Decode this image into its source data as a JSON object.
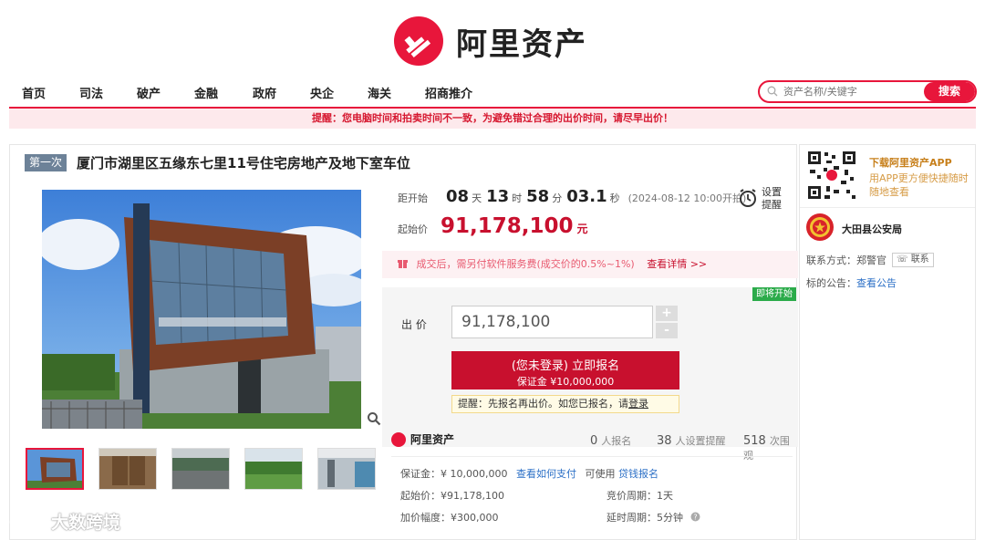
{
  "brand": {
    "name": "阿里资产",
    "accent": "#e8163b"
  },
  "nav": {
    "items": [
      "首页",
      "司法",
      "破产",
      "金融",
      "政府",
      "央企",
      "海关",
      "招商推介"
    ]
  },
  "search": {
    "placeholder": "资产名称/关键字",
    "button": "搜索"
  },
  "notice": "提醒：您电脑时间和拍卖时间不一致，为避免错过合理的出价时间，请尽早出价！",
  "auction": {
    "round_badge": "第一次",
    "title": "厦门市湖里区五缘东七里11号住宅房地产及地下室车位",
    "countdown_label": "距开始",
    "countdown": {
      "days": "08",
      "days_unit": "天",
      "hours": "13",
      "hours_unit": "时",
      "minutes": "58",
      "minutes_unit": "分",
      "seconds": "03.1",
      "seconds_unit": "秒"
    },
    "start_time": "(2024-08-12 10:00开拍)",
    "set_reminder": "设置提醒",
    "start_price_label": "起始价",
    "start_price": "91,178,100",
    "start_price_unit": "元",
    "fee_text": "成交后，需另付软件服务费(成交价的0.5%~1%)",
    "fee_link": "查看详情 >>",
    "status_badge": "即将开始",
    "bid_label": "出 价",
    "bid_value": "91,178,100",
    "plus": "+",
    "minus": "-",
    "register_line1": "(您未登录) 立即报名",
    "register_line2": "保证金 ¥10,000,000",
    "tip_text": "提醒：先报名再出价。如您已报名，请",
    "tip_link": "登录"
  },
  "stats": {
    "brand": "阿里资产",
    "registered": "0",
    "registered_label": "人报名",
    "reminders": "38",
    "reminders_label": "人设置提醒",
    "watchers": "518",
    "watchers_label": "次围观"
  },
  "details": {
    "deposit": "保证金：¥ 10,000,000",
    "deposit_link": "查看如何支付",
    "loan_prefix": "可使用",
    "loan_link": "贷钱报名",
    "start_price": "起始价：¥91,178,100",
    "bid_cycle": "竞价周期：1天",
    "increment": "加价幅度：¥300,000",
    "delay_cycle": "延时周期：5分钟"
  },
  "sidebar": {
    "app_title": "下载阿里资产APP",
    "app_sub": "用APP更方便快捷随时随地查看",
    "org": "大田县公安局",
    "contact_label": "联系方式：郑警官",
    "contact_btn": "联系",
    "announce_label": "标的公告：",
    "announce_link": "查看公告"
  },
  "watermark": "大数跨境"
}
